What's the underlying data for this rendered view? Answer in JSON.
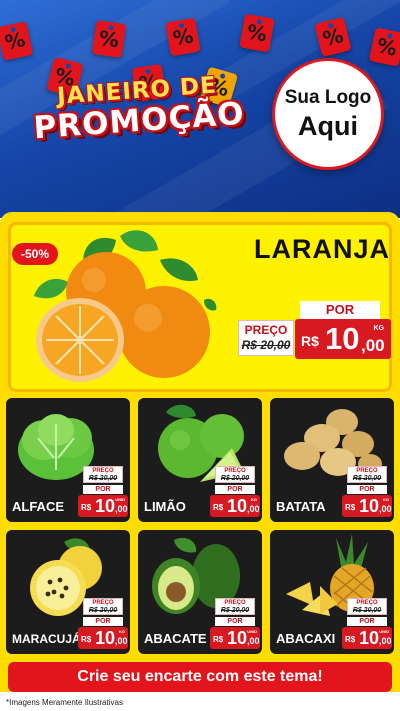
{
  "header": {
    "title_line1": "JANEIRO DE",
    "title_line2": "PROMOÇÃO",
    "logo_line1": "Sua Logo",
    "logo_line2": "Aqui",
    "tag_symbol": "%",
    "colors": {
      "background": "#1546a8",
      "tag": "#e3151c",
      "title_fill": "#ffffff",
      "title_outline": "#c4101a"
    }
  },
  "featured": {
    "name": "LARANJA",
    "discount_badge": "-50%",
    "preco_label": "PREÇO",
    "old_price": "R$ 20,00",
    "por_label": "POR",
    "currency": "R$",
    "price_int": "10",
    "price_cents": ",00",
    "unit": "KG"
  },
  "products": [
    {
      "name": "ALFACE",
      "preco_label": "PREÇO",
      "old_price": "R$ 20,00",
      "por_label": "POR",
      "currency": "R$",
      "price_int": "10",
      "price_cents": ",00",
      "unit": "UNID"
    },
    {
      "name": "LIMÃO",
      "preco_label": "PREÇO",
      "old_price": "R$ 20,00",
      "por_label": "POR",
      "currency": "R$",
      "price_int": "10",
      "price_cents": ",00",
      "unit": "KG"
    },
    {
      "name": "BATATA",
      "preco_label": "PREÇO",
      "old_price": "R$ 20,00",
      "por_label": "POR",
      "currency": "R$",
      "price_int": "10",
      "price_cents": ",00",
      "unit": "KG"
    },
    {
      "name": "MARACUJÁ",
      "preco_label": "PREÇO",
      "old_price": "R$ 20,00",
      "por_label": "POR",
      "currency": "R$",
      "price_int": "10",
      "price_cents": ",00",
      "unit": "KG"
    },
    {
      "name": "ABACATE",
      "preco_label": "PREÇO",
      "old_price": "R$ 20,00",
      "por_label": "POR",
      "currency": "R$",
      "price_int": "10",
      "price_cents": ",00",
      "unit": "UNID"
    },
    {
      "name": "ABACAXI",
      "preco_label": "PREÇO",
      "old_price": "R$ 20,00",
      "por_label": "POR",
      "currency": "R$",
      "price_int": "10",
      "price_cents": ",00",
      "unit": "UNID"
    }
  ],
  "cta": {
    "label": "Crie seu encarte com este tema!"
  },
  "footer": {
    "disclaimer": "*Imagens Meramente Ilustrativas"
  },
  "colors": {
    "panel": "#ffdd00",
    "card": "#1c1c1c",
    "price_red": "#d81922",
    "cta_red": "#e3151c"
  }
}
